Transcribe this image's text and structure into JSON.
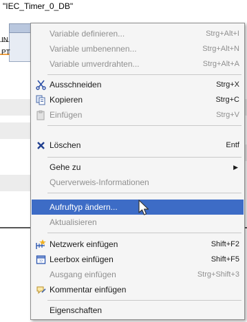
{
  "block": {
    "db_name": "\"IEC_Timer_0_DB\"",
    "pin_in": "IN",
    "pin_pt": "PT"
  },
  "context_menu": {
    "items": [
      {
        "label": "Variable definieren...",
        "shortcut": "Strg+Alt+I",
        "enabled": false,
        "icon": ""
      },
      {
        "label": "Variable umbenennen...",
        "shortcut": "Strg+Alt+N",
        "enabled": false,
        "icon": ""
      },
      {
        "label": "Variable umverdrahten...",
        "shortcut": "Strg+Alt+A",
        "enabled": false,
        "icon": ""
      },
      {
        "label": "Ausschneiden",
        "shortcut": "Strg+X",
        "enabled": true,
        "icon": "scissors-icon"
      },
      {
        "label": "Kopieren",
        "shortcut": "Strg+C",
        "enabled": true,
        "icon": "copy-icon"
      },
      {
        "label": "Einfügen",
        "shortcut": "Strg+V",
        "enabled": false,
        "icon": "paste-icon"
      },
      {
        "label": "Löschen",
        "shortcut": "Entf",
        "enabled": true,
        "icon": "delete-icon"
      },
      {
        "label": "Gehe zu",
        "shortcut": "",
        "enabled": true,
        "icon": "",
        "submenu": true
      },
      {
        "label": "Querverweis-Informationen",
        "shortcut": "",
        "enabled": false,
        "icon": ""
      },
      {
        "label": "Aufruftyp ändern...",
        "shortcut": "",
        "enabled": true,
        "icon": "",
        "highlighted": true
      },
      {
        "label": "Aktualisieren",
        "shortcut": "",
        "enabled": false,
        "icon": ""
      },
      {
        "label": "Netzwerk einfügen",
        "shortcut": "Shift+F2",
        "enabled": true,
        "icon": "insert-network-icon"
      },
      {
        "label": "Leerbox einfügen",
        "shortcut": "Shift+F5",
        "enabled": true,
        "icon": "empty-box-icon"
      },
      {
        "label": "Ausgang einfügen",
        "shortcut": "Strg+Shift+3",
        "enabled": false,
        "icon": ""
      },
      {
        "label": "Kommentar einfügen",
        "shortcut": "",
        "enabled": true,
        "icon": "comment-icon"
      },
      {
        "label": "Eigenschaften",
        "shortcut": "",
        "enabled": true,
        "icon": ""
      }
    ]
  },
  "colors": {
    "highlight": "#3d6cc6",
    "menu_bg": "#f5f5f5",
    "disabled_text": "#8f8f8f"
  }
}
